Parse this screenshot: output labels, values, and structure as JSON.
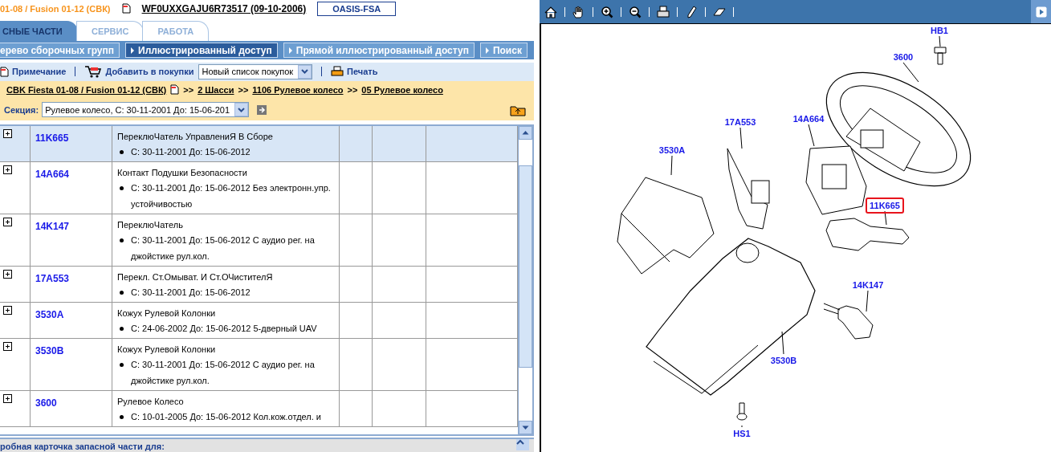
{
  "header": {
    "vehicle": "01-08 / Fusion 01-12 (СВК)",
    "vin": "WF0UXXGAJU6R73517 (09-10-2006)",
    "button": "OASIS-FSA"
  },
  "tabs": [
    {
      "label": "СНЫЕ ЧАСТИ",
      "selected": true
    },
    {
      "label": "СЕРВИС",
      "selected": false
    },
    {
      "label": "РАБОТА",
      "selected": false
    }
  ],
  "nav": [
    {
      "label": "ерево сборочных групп",
      "selected": false,
      "kind": "cut"
    },
    {
      "label": "Иллюстрированный доступ",
      "selected": true,
      "kind": "arrow"
    },
    {
      "label": "Прямой иллюстрированный доступ",
      "selected": false,
      "kind": "arrow"
    },
    {
      "label": "Поиск",
      "selected": false,
      "kind": "arrow"
    }
  ],
  "toolbar": {
    "note": "Примечание",
    "add": "Добавить в покупки",
    "list_select": "Новый список покупок",
    "print": "Печать"
  },
  "breadcrumb": [
    {
      "kind": "link",
      "text": "CBK Fiesta 01-08 / Fusion 01-12 (СВК)"
    },
    {
      "kind": "sep",
      "text": ">>"
    },
    {
      "kind": "link",
      "text": "2 Шасси"
    },
    {
      "kind": "sep",
      "text": ">>"
    },
    {
      "kind": "link",
      "text": "1106 Рулевое колесо"
    },
    {
      "kind": "sep",
      "text": ">>"
    },
    {
      "kind": "link",
      "text": "05 Рулевое колесо"
    }
  ],
  "section": {
    "label": "Секция:",
    "value": "Рулевое колесо, С: 30-11-2001 До: 15-06-201"
  },
  "parts": [
    {
      "code": "11K665",
      "name": "ПереклюЧатель УправлениЯ В Сборе",
      "detail": "С: 30-11-2001 До: 15-06-2012",
      "selected": true
    },
    {
      "code": "14A664",
      "name": "Контакт Подушки Безопасности",
      "detail": "С: 30-11-2001 До: 15-06-2012 Без электронн.упр. устойчивостью",
      "selected": false
    },
    {
      "code": "14K147",
      "name": "ПереклюЧатель",
      "detail": "С: 30-11-2001 До: 15-06-2012 С аудио рег. на джойстике рул.кол.",
      "selected": false
    },
    {
      "code": "17A553",
      "name": "Перекл. Ст.Омыват. И Ст.ОЧистителЯ",
      "detail": "С: 30-11-2001 До: 15-06-2012",
      "selected": false
    },
    {
      "code": "3530A",
      "name": "Кожух Рулевой Колонки",
      "detail": "С: 24-06-2002 До: 15-06-2012 5-дверный UAV",
      "selected": false
    },
    {
      "code": "3530B",
      "name": "Кожух Рулевой Колонки",
      "detail": "С: 30-11-2001 До: 15-06-2012 С аудио рег. на джойстике рул.кол.",
      "selected": false
    },
    {
      "code": "3600",
      "name": "Рулевое Колесо",
      "detail": "С: 10-01-2005 До: 15-06-2012 Кол.кож.отдел. и",
      "selected": false
    }
  ],
  "bottom_panel": {
    "title": "робная карточка запасной части для:"
  },
  "diagram": {
    "callouts": [
      {
        "label": "HB1",
        "selected": false
      },
      {
        "label": "3600",
        "selected": false
      },
      {
        "label": "17A553",
        "selected": false
      },
      {
        "label": "14A664",
        "selected": false
      },
      {
        "label": "3530A",
        "selected": false
      },
      {
        "label": "11K665",
        "selected": true
      },
      {
        "label": "14K147",
        "selected": false
      },
      {
        "label": "3530B",
        "selected": false
      },
      {
        "label": "HS1",
        "selected": false
      }
    ]
  }
}
